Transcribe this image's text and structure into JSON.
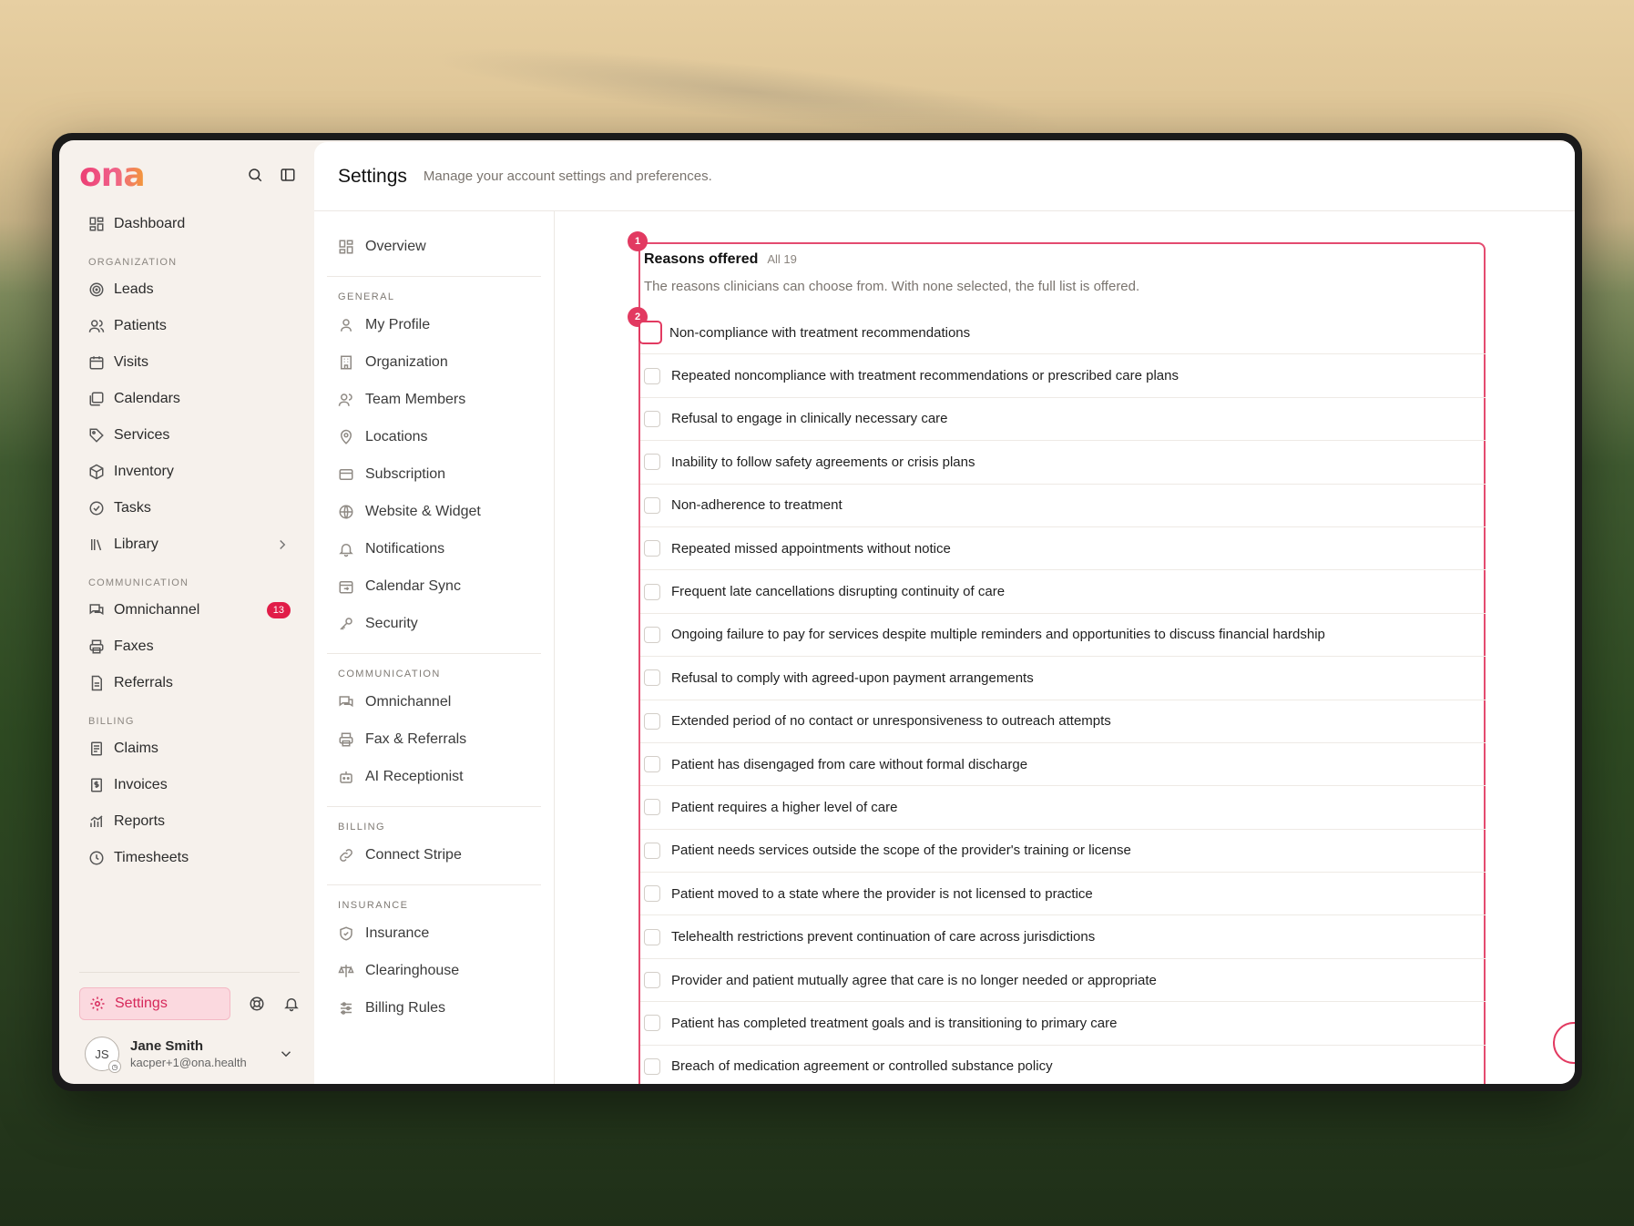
{
  "app": {
    "logo": "ona",
    "title": "Settings",
    "subtitle": "Manage your account settings and preferences."
  },
  "nav": {
    "dashboard": "Dashboard",
    "sections": [
      {
        "label": "ORGANIZATION",
        "items": [
          {
            "label": "Leads",
            "icon": "target-icon"
          },
          {
            "label": "Patients",
            "icon": "users-icon"
          },
          {
            "label": "Visits",
            "icon": "calendar-icon"
          },
          {
            "label": "Calendars",
            "icon": "calendars-icon"
          },
          {
            "label": "Services",
            "icon": "tag-icon"
          },
          {
            "label": "Inventory",
            "icon": "box-icon"
          },
          {
            "label": "Tasks",
            "icon": "check-circle-icon"
          },
          {
            "label": "Library",
            "icon": "library-icon"
          }
        ]
      },
      {
        "label": "COMMUNICATION",
        "items": [
          {
            "label": "Omnichannel",
            "icon": "chat-icon",
            "badge": "13"
          },
          {
            "label": "Faxes",
            "icon": "printer-icon"
          },
          {
            "label": "Referrals",
            "icon": "file-icon"
          }
        ]
      },
      {
        "label": "BILLING",
        "items": [
          {
            "label": "Claims",
            "icon": "document-icon"
          },
          {
            "label": "Invoices",
            "icon": "invoice-icon"
          },
          {
            "label": "Reports",
            "icon": "chart-icon"
          },
          {
            "label": "Timesheets",
            "icon": "clock-icon"
          }
        ]
      }
    ],
    "settings_label": "Settings",
    "user": {
      "initials": "JS",
      "name": "Jane Smith",
      "email": "kacper+1@ona.health"
    }
  },
  "subnav": {
    "overview": "Overview",
    "general_label": "GENERAL",
    "general": [
      "My Profile",
      "Organization",
      "Team Members",
      "Locations",
      "Subscription",
      "Website & Widget",
      "Notifications",
      "Calendar Sync",
      "Security"
    ],
    "communication_label": "COMMUNICATION",
    "communication": [
      "Omnichannel",
      "Fax & Referrals",
      "AI Receptionist"
    ],
    "billing_label": "BILLING",
    "billing": [
      "Connect Stripe"
    ],
    "insurance_label": "INSURANCE",
    "insurance": [
      "Insurance",
      "Clearinghouse",
      "Billing Rules"
    ]
  },
  "panel": {
    "marker1": "1",
    "marker2": "2",
    "title": "Reasons offered",
    "count": "All 19",
    "description": "The reasons clinicians can choose from. With none selected, the full list is offered.",
    "reasons": [
      "Non-compliance with treatment recommendations",
      "Repeated noncompliance with treatment recommendations or prescribed care plans",
      "Refusal to engage in clinically necessary care",
      "Inability to follow safety agreements or crisis plans",
      "Non-adherence to treatment",
      "Repeated missed appointments without notice",
      "Frequent late cancellations disrupting continuity of care",
      "Ongoing failure to pay for services despite multiple reminders and opportunities to discuss financial hardship",
      "Refusal to comply with agreed-upon payment arrangements",
      "Extended period of no contact or unresponsiveness to outreach attempts",
      "Patient has disengaged from care without formal discharge",
      "Patient requires a higher level of care",
      "Patient needs services outside the scope of the provider's training or license",
      "Patient moved to a state where the provider is not licensed to practice",
      "Telehealth restrictions prevent continuation of care across jurisdictions",
      "Provider and patient mutually agree that care is no longer needed or appropriate",
      "Patient has completed treatment goals and is transitioning to primary care",
      "Breach of medication agreement or controlled substance policy"
    ]
  }
}
